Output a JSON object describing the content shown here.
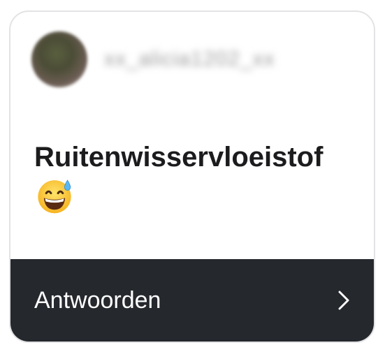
{
  "post": {
    "username": "xx_alicia1202_xx",
    "message": "Ruitenwisservloeistof",
    "emoji": "grinning-face-with-sweat"
  },
  "footer": {
    "reply_label": "Antwoorden",
    "icon": "chevron-right-icon"
  },
  "colors": {
    "footer_bg": "#25282d",
    "text": "#1c1c1e",
    "border": "#e3e3e5"
  }
}
